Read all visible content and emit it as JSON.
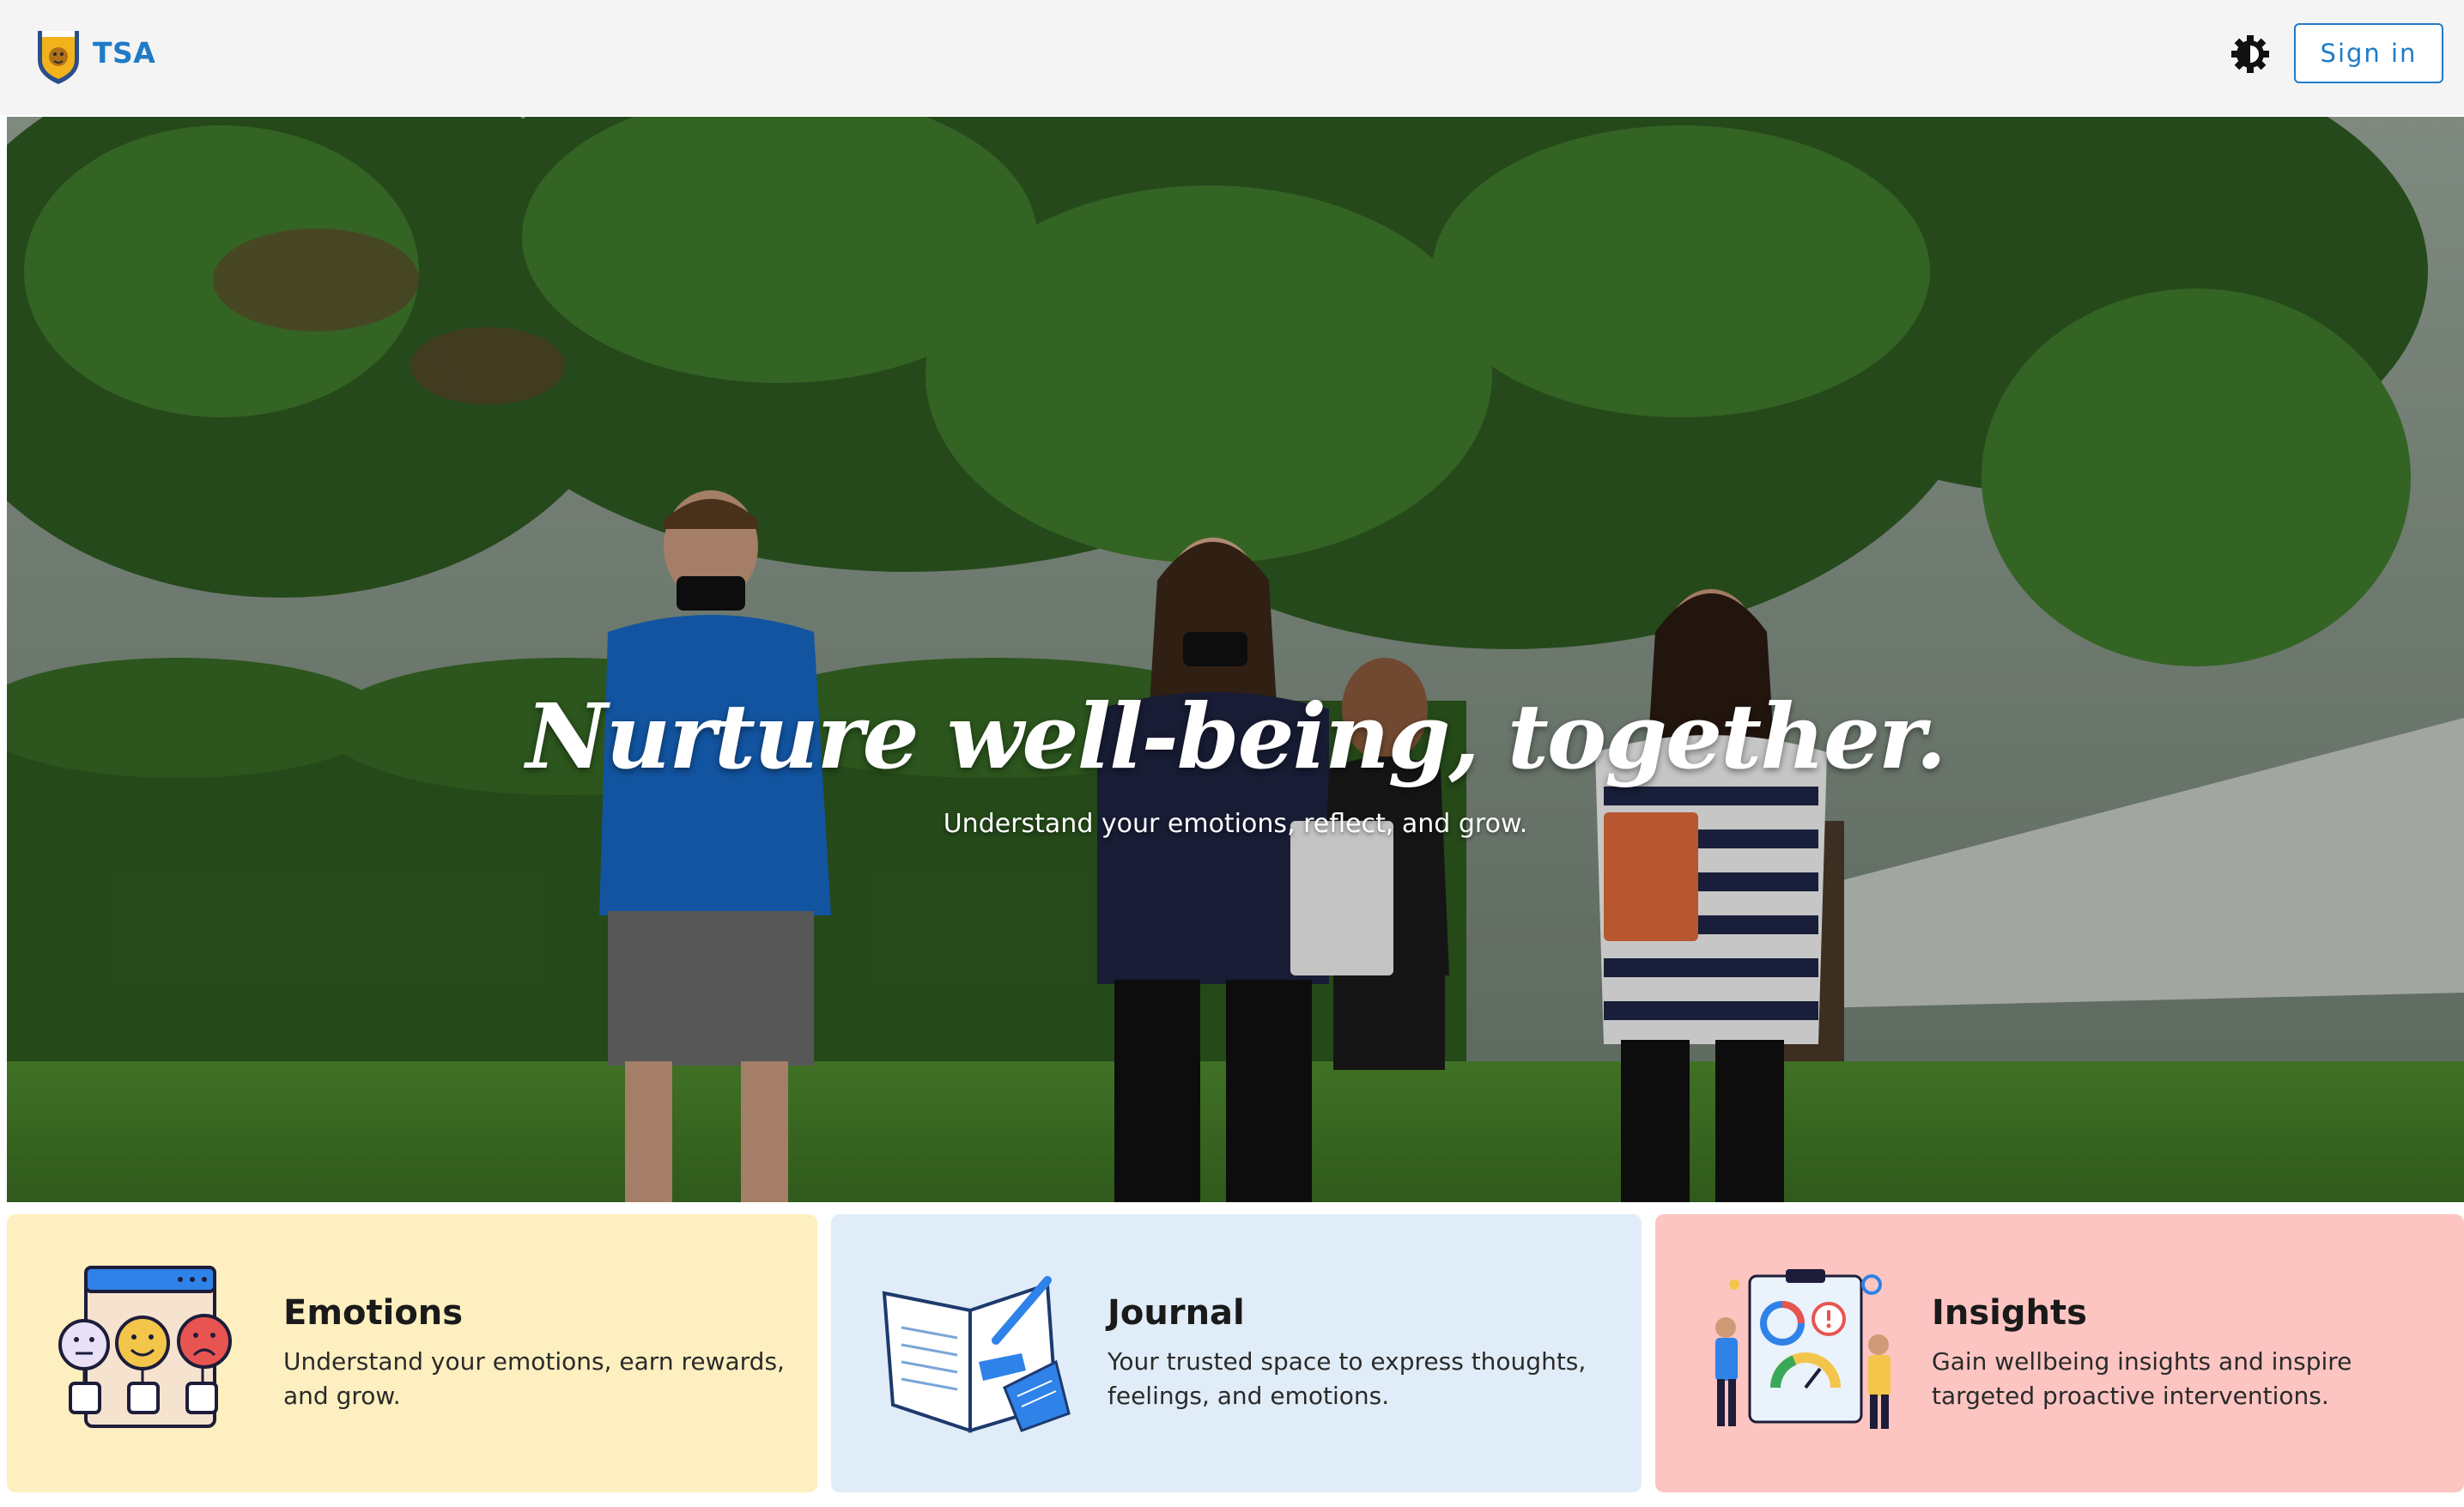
{
  "header": {
    "brand": "TSA",
    "sign_in_label": "Sign in"
  },
  "hero": {
    "title": "Nurture well-being, together.",
    "subtitle": "Understand your emotions, reflect, and grow."
  },
  "cards": [
    {
      "title": "Emotions",
      "description": "Understand your emotions, earn rewards, and grow.",
      "icon": "emotions-illustration",
      "background": "#fdefbf"
    },
    {
      "title": "Journal",
      "description": "Your trusted space to express thoughts, feelings, and emotions.",
      "icon": "journal-illustration",
      "background": "#e0edf8"
    },
    {
      "title": "Insights",
      "description": "Gain wellbeing insights and inspire targeted proactive interventions.",
      "icon": "insights-illustration",
      "background": "#fdc5c2"
    }
  ],
  "colors": {
    "accent": "#1f7bc7",
    "header_background": "#f4f4f4"
  }
}
